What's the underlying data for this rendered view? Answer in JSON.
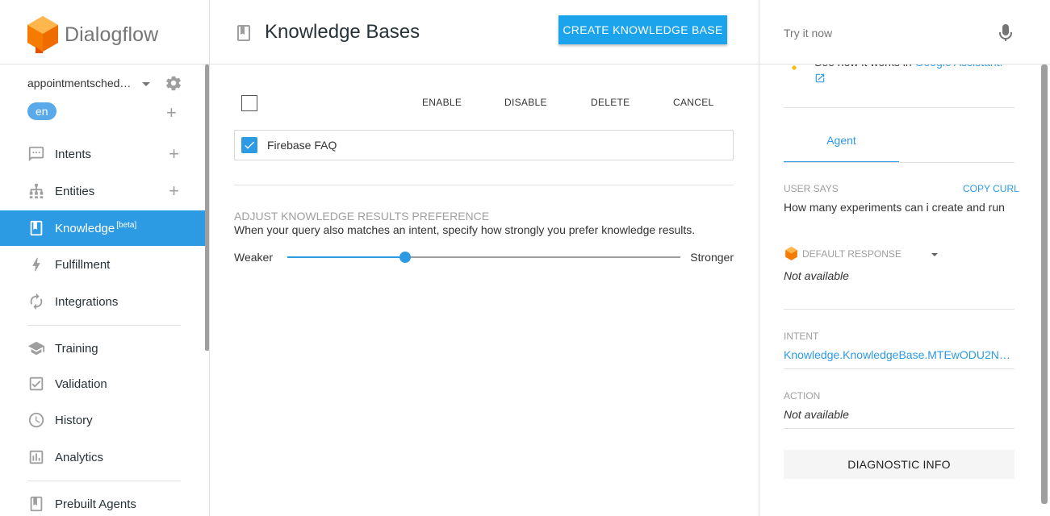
{
  "app": {
    "name": "Dialogflow"
  },
  "sidebar": {
    "agent_name": "appointmentsched…",
    "language": "en",
    "items": [
      {
        "label": "Intents",
        "icon": "chat-icon"
      },
      {
        "label": "Entities",
        "icon": "hierarchy-icon"
      },
      {
        "label": "Knowledge",
        "badge": "[beta]",
        "icon": "book-icon"
      },
      {
        "label": "Fulfillment",
        "icon": "bolt-icon"
      },
      {
        "label": "Integrations",
        "icon": "refresh-icon"
      },
      {
        "label": "Training",
        "icon": "graduation-cap-icon"
      },
      {
        "label": "Validation",
        "icon": "check-square-icon"
      },
      {
        "label": "History",
        "icon": "clock-icon"
      },
      {
        "label": "Analytics",
        "icon": "bar-chart-icon"
      },
      {
        "label": "Prebuilt Agents",
        "icon": "book-icon"
      }
    ],
    "active": "Knowledge"
  },
  "main": {
    "title": "Knowledge Bases",
    "create_label": "CREATE KNOWLEDGE BASE",
    "toolbar": {
      "enable": "ENABLE",
      "disable": "DISABLE",
      "delete": "DELETE",
      "cancel": "CANCEL"
    },
    "knowledge_bases": [
      {
        "name": "Firebase FAQ",
        "checked": true
      }
    ],
    "preference": {
      "title": "ADJUST KNOWLEDGE RESULTS PREFERENCE",
      "description": "When your query also matches an intent, specify how strongly you prefer knowledge results.",
      "weaker": "Weaker",
      "stronger": "Stronger",
      "value": 0.3
    }
  },
  "right": {
    "try_placeholder": "Try it now",
    "assistant_text": "See how it works in ",
    "assistant_link": "Google Assistant.",
    "tab": "Agent",
    "user_says_label": "USER SAYS",
    "copy_curl": "COPY CURL",
    "user_says": "How many experiments can i create and run",
    "default_response_label": "DEFAULT RESPONSE",
    "default_response": "Not available",
    "intent_label": "INTENT",
    "intent": "Knowledge.KnowledgeBase.MTEwODU2NzQ…",
    "action_label": "ACTION",
    "action": "Not available",
    "diagnostic": "DIAGNOSTIC INFO"
  },
  "colors": {
    "accent": "#2d9ae4",
    "button": "#1ba3ec",
    "logo": "#ff9800"
  }
}
